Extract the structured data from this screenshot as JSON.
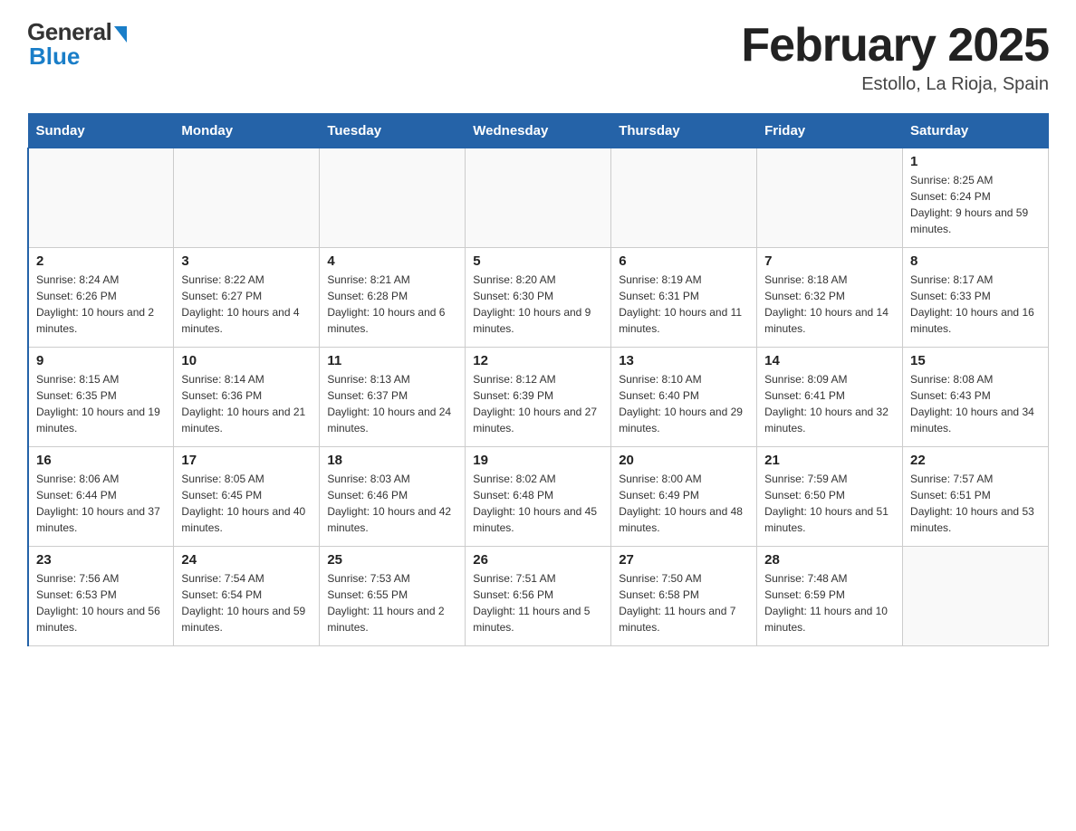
{
  "header": {
    "logo_general": "General",
    "logo_blue": "Blue",
    "month_title": "February 2025",
    "location": "Estollo, La Rioja, Spain"
  },
  "weekdays": [
    "Sunday",
    "Monday",
    "Tuesday",
    "Wednesday",
    "Thursday",
    "Friday",
    "Saturday"
  ],
  "weeks": [
    [
      {
        "day": "",
        "sunrise": "",
        "sunset": "",
        "daylight": ""
      },
      {
        "day": "",
        "sunrise": "",
        "sunset": "",
        "daylight": ""
      },
      {
        "day": "",
        "sunrise": "",
        "sunset": "",
        "daylight": ""
      },
      {
        "day": "",
        "sunrise": "",
        "sunset": "",
        "daylight": ""
      },
      {
        "day": "",
        "sunrise": "",
        "sunset": "",
        "daylight": ""
      },
      {
        "day": "",
        "sunrise": "",
        "sunset": "",
        "daylight": ""
      },
      {
        "day": "1",
        "sunrise": "Sunrise: 8:25 AM",
        "sunset": "Sunset: 6:24 PM",
        "daylight": "Daylight: 9 hours and 59 minutes."
      }
    ],
    [
      {
        "day": "2",
        "sunrise": "Sunrise: 8:24 AM",
        "sunset": "Sunset: 6:26 PM",
        "daylight": "Daylight: 10 hours and 2 minutes."
      },
      {
        "day": "3",
        "sunrise": "Sunrise: 8:22 AM",
        "sunset": "Sunset: 6:27 PM",
        "daylight": "Daylight: 10 hours and 4 minutes."
      },
      {
        "day": "4",
        "sunrise": "Sunrise: 8:21 AM",
        "sunset": "Sunset: 6:28 PM",
        "daylight": "Daylight: 10 hours and 6 minutes."
      },
      {
        "day": "5",
        "sunrise": "Sunrise: 8:20 AM",
        "sunset": "Sunset: 6:30 PM",
        "daylight": "Daylight: 10 hours and 9 minutes."
      },
      {
        "day": "6",
        "sunrise": "Sunrise: 8:19 AM",
        "sunset": "Sunset: 6:31 PM",
        "daylight": "Daylight: 10 hours and 11 minutes."
      },
      {
        "day": "7",
        "sunrise": "Sunrise: 8:18 AM",
        "sunset": "Sunset: 6:32 PM",
        "daylight": "Daylight: 10 hours and 14 minutes."
      },
      {
        "day": "8",
        "sunrise": "Sunrise: 8:17 AM",
        "sunset": "Sunset: 6:33 PM",
        "daylight": "Daylight: 10 hours and 16 minutes."
      }
    ],
    [
      {
        "day": "9",
        "sunrise": "Sunrise: 8:15 AM",
        "sunset": "Sunset: 6:35 PM",
        "daylight": "Daylight: 10 hours and 19 minutes."
      },
      {
        "day": "10",
        "sunrise": "Sunrise: 8:14 AM",
        "sunset": "Sunset: 6:36 PM",
        "daylight": "Daylight: 10 hours and 21 minutes."
      },
      {
        "day": "11",
        "sunrise": "Sunrise: 8:13 AM",
        "sunset": "Sunset: 6:37 PM",
        "daylight": "Daylight: 10 hours and 24 minutes."
      },
      {
        "day": "12",
        "sunrise": "Sunrise: 8:12 AM",
        "sunset": "Sunset: 6:39 PM",
        "daylight": "Daylight: 10 hours and 27 minutes."
      },
      {
        "day": "13",
        "sunrise": "Sunrise: 8:10 AM",
        "sunset": "Sunset: 6:40 PM",
        "daylight": "Daylight: 10 hours and 29 minutes."
      },
      {
        "day": "14",
        "sunrise": "Sunrise: 8:09 AM",
        "sunset": "Sunset: 6:41 PM",
        "daylight": "Daylight: 10 hours and 32 minutes."
      },
      {
        "day": "15",
        "sunrise": "Sunrise: 8:08 AM",
        "sunset": "Sunset: 6:43 PM",
        "daylight": "Daylight: 10 hours and 34 minutes."
      }
    ],
    [
      {
        "day": "16",
        "sunrise": "Sunrise: 8:06 AM",
        "sunset": "Sunset: 6:44 PM",
        "daylight": "Daylight: 10 hours and 37 minutes."
      },
      {
        "day": "17",
        "sunrise": "Sunrise: 8:05 AM",
        "sunset": "Sunset: 6:45 PM",
        "daylight": "Daylight: 10 hours and 40 minutes."
      },
      {
        "day": "18",
        "sunrise": "Sunrise: 8:03 AM",
        "sunset": "Sunset: 6:46 PM",
        "daylight": "Daylight: 10 hours and 42 minutes."
      },
      {
        "day": "19",
        "sunrise": "Sunrise: 8:02 AM",
        "sunset": "Sunset: 6:48 PM",
        "daylight": "Daylight: 10 hours and 45 minutes."
      },
      {
        "day": "20",
        "sunrise": "Sunrise: 8:00 AM",
        "sunset": "Sunset: 6:49 PM",
        "daylight": "Daylight: 10 hours and 48 minutes."
      },
      {
        "day": "21",
        "sunrise": "Sunrise: 7:59 AM",
        "sunset": "Sunset: 6:50 PM",
        "daylight": "Daylight: 10 hours and 51 minutes."
      },
      {
        "day": "22",
        "sunrise": "Sunrise: 7:57 AM",
        "sunset": "Sunset: 6:51 PM",
        "daylight": "Daylight: 10 hours and 53 minutes."
      }
    ],
    [
      {
        "day": "23",
        "sunrise": "Sunrise: 7:56 AM",
        "sunset": "Sunset: 6:53 PM",
        "daylight": "Daylight: 10 hours and 56 minutes."
      },
      {
        "day": "24",
        "sunrise": "Sunrise: 7:54 AM",
        "sunset": "Sunset: 6:54 PM",
        "daylight": "Daylight: 10 hours and 59 minutes."
      },
      {
        "day": "25",
        "sunrise": "Sunrise: 7:53 AM",
        "sunset": "Sunset: 6:55 PM",
        "daylight": "Daylight: 11 hours and 2 minutes."
      },
      {
        "day": "26",
        "sunrise": "Sunrise: 7:51 AM",
        "sunset": "Sunset: 6:56 PM",
        "daylight": "Daylight: 11 hours and 5 minutes."
      },
      {
        "day": "27",
        "sunrise": "Sunrise: 7:50 AM",
        "sunset": "Sunset: 6:58 PM",
        "daylight": "Daylight: 11 hours and 7 minutes."
      },
      {
        "day": "28",
        "sunrise": "Sunrise: 7:48 AM",
        "sunset": "Sunset: 6:59 PM",
        "daylight": "Daylight: 11 hours and 10 minutes."
      },
      {
        "day": "",
        "sunrise": "",
        "sunset": "",
        "daylight": ""
      }
    ]
  ]
}
